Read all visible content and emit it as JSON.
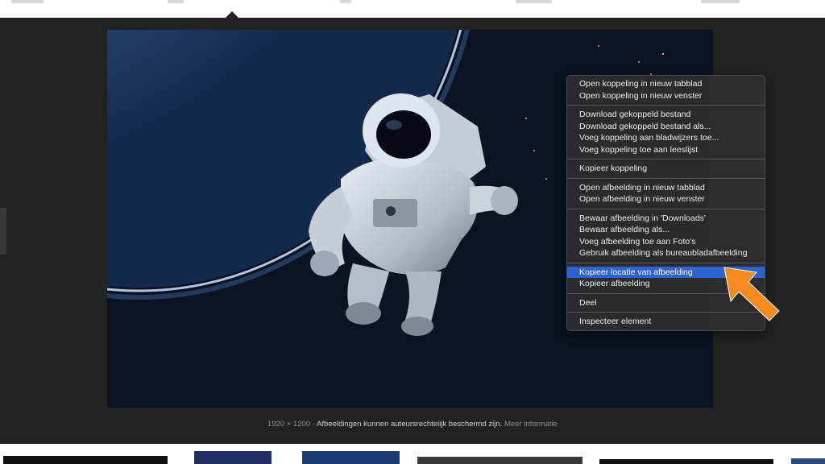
{
  "caption": {
    "dimensions": "1920 × 1200",
    "separator": "-",
    "notice": "Afbeeldingen kunnen auteursrechtelijk beschermd zijn.",
    "more_info": "Meer informatie"
  },
  "context_menu": {
    "groups": [
      [
        "Open koppeling in nieuw tabblad",
        "Open koppeling in nieuw venster"
      ],
      [
        "Download gekoppeld bestand",
        "Download gekoppeld bestand als...",
        "Voeg koppeling aan bladwijzers toe...",
        "Voeg koppeling toe aan leeslijst"
      ],
      [
        "Kopieer koppeling"
      ],
      [
        "Open afbeelding in nieuw tabblad",
        "Open afbeelding in nieuw venster"
      ],
      [
        "Bewaar afbeelding in 'Downloads'",
        "Bewaar afbeelding als...",
        "Voeg afbeelding toe aan Foto's",
        "Gebruik afbeelding als bureaubladafbeelding"
      ],
      [
        "Kopieer locatie van afbeelding",
        "Kopieer afbeelding"
      ],
      [
        "Deel"
      ],
      [
        "Inspecteer element"
      ]
    ],
    "highlighted_item": "Kopieer locatie van afbeelding"
  },
  "colors": {
    "viewer_bg": "#222222",
    "menu_bg": "#2c2c2e",
    "menu_highlight": "#2e62cf",
    "annotation_arrow": "#f58a1f"
  },
  "icons": {
    "annotation": "pointer-arrow-icon"
  }
}
